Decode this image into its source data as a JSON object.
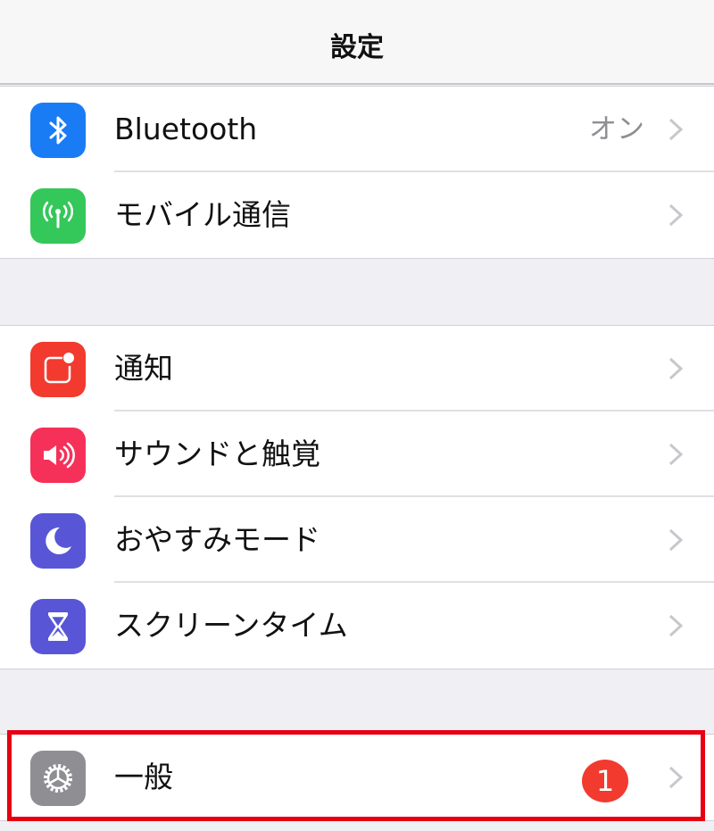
{
  "header": {
    "title": "設定"
  },
  "groups": [
    {
      "items": [
        {
          "label": "Bluetooth",
          "value": "オン",
          "icon": "bluetooth-icon",
          "icon_color": "#1a7cf5"
        },
        {
          "label": "モバイル通信",
          "value": "",
          "icon": "antenna-icon",
          "icon_color": "#34c759"
        }
      ]
    },
    {
      "items": [
        {
          "label": "通知",
          "icon": "notification-icon",
          "icon_color": "#f23a2f"
        },
        {
          "label": "サウンドと触覚",
          "icon": "speaker-icon",
          "icon_color": "#f5315a"
        },
        {
          "label": "おやすみモード",
          "icon": "moon-icon",
          "icon_color": "#5856d6"
        },
        {
          "label": "スクリーンタイム",
          "icon": "hourglass-icon",
          "icon_color": "#5856d6"
        }
      ]
    },
    {
      "items": [
        {
          "label": "一般",
          "badge": "1",
          "icon": "gear-icon",
          "icon_color": "#8e8e93"
        }
      ]
    }
  ],
  "colors": {
    "highlight_border": "#e60012",
    "badge": "#f23a2f",
    "chevron": "#c7c7cc",
    "background": "#efeff4"
  }
}
